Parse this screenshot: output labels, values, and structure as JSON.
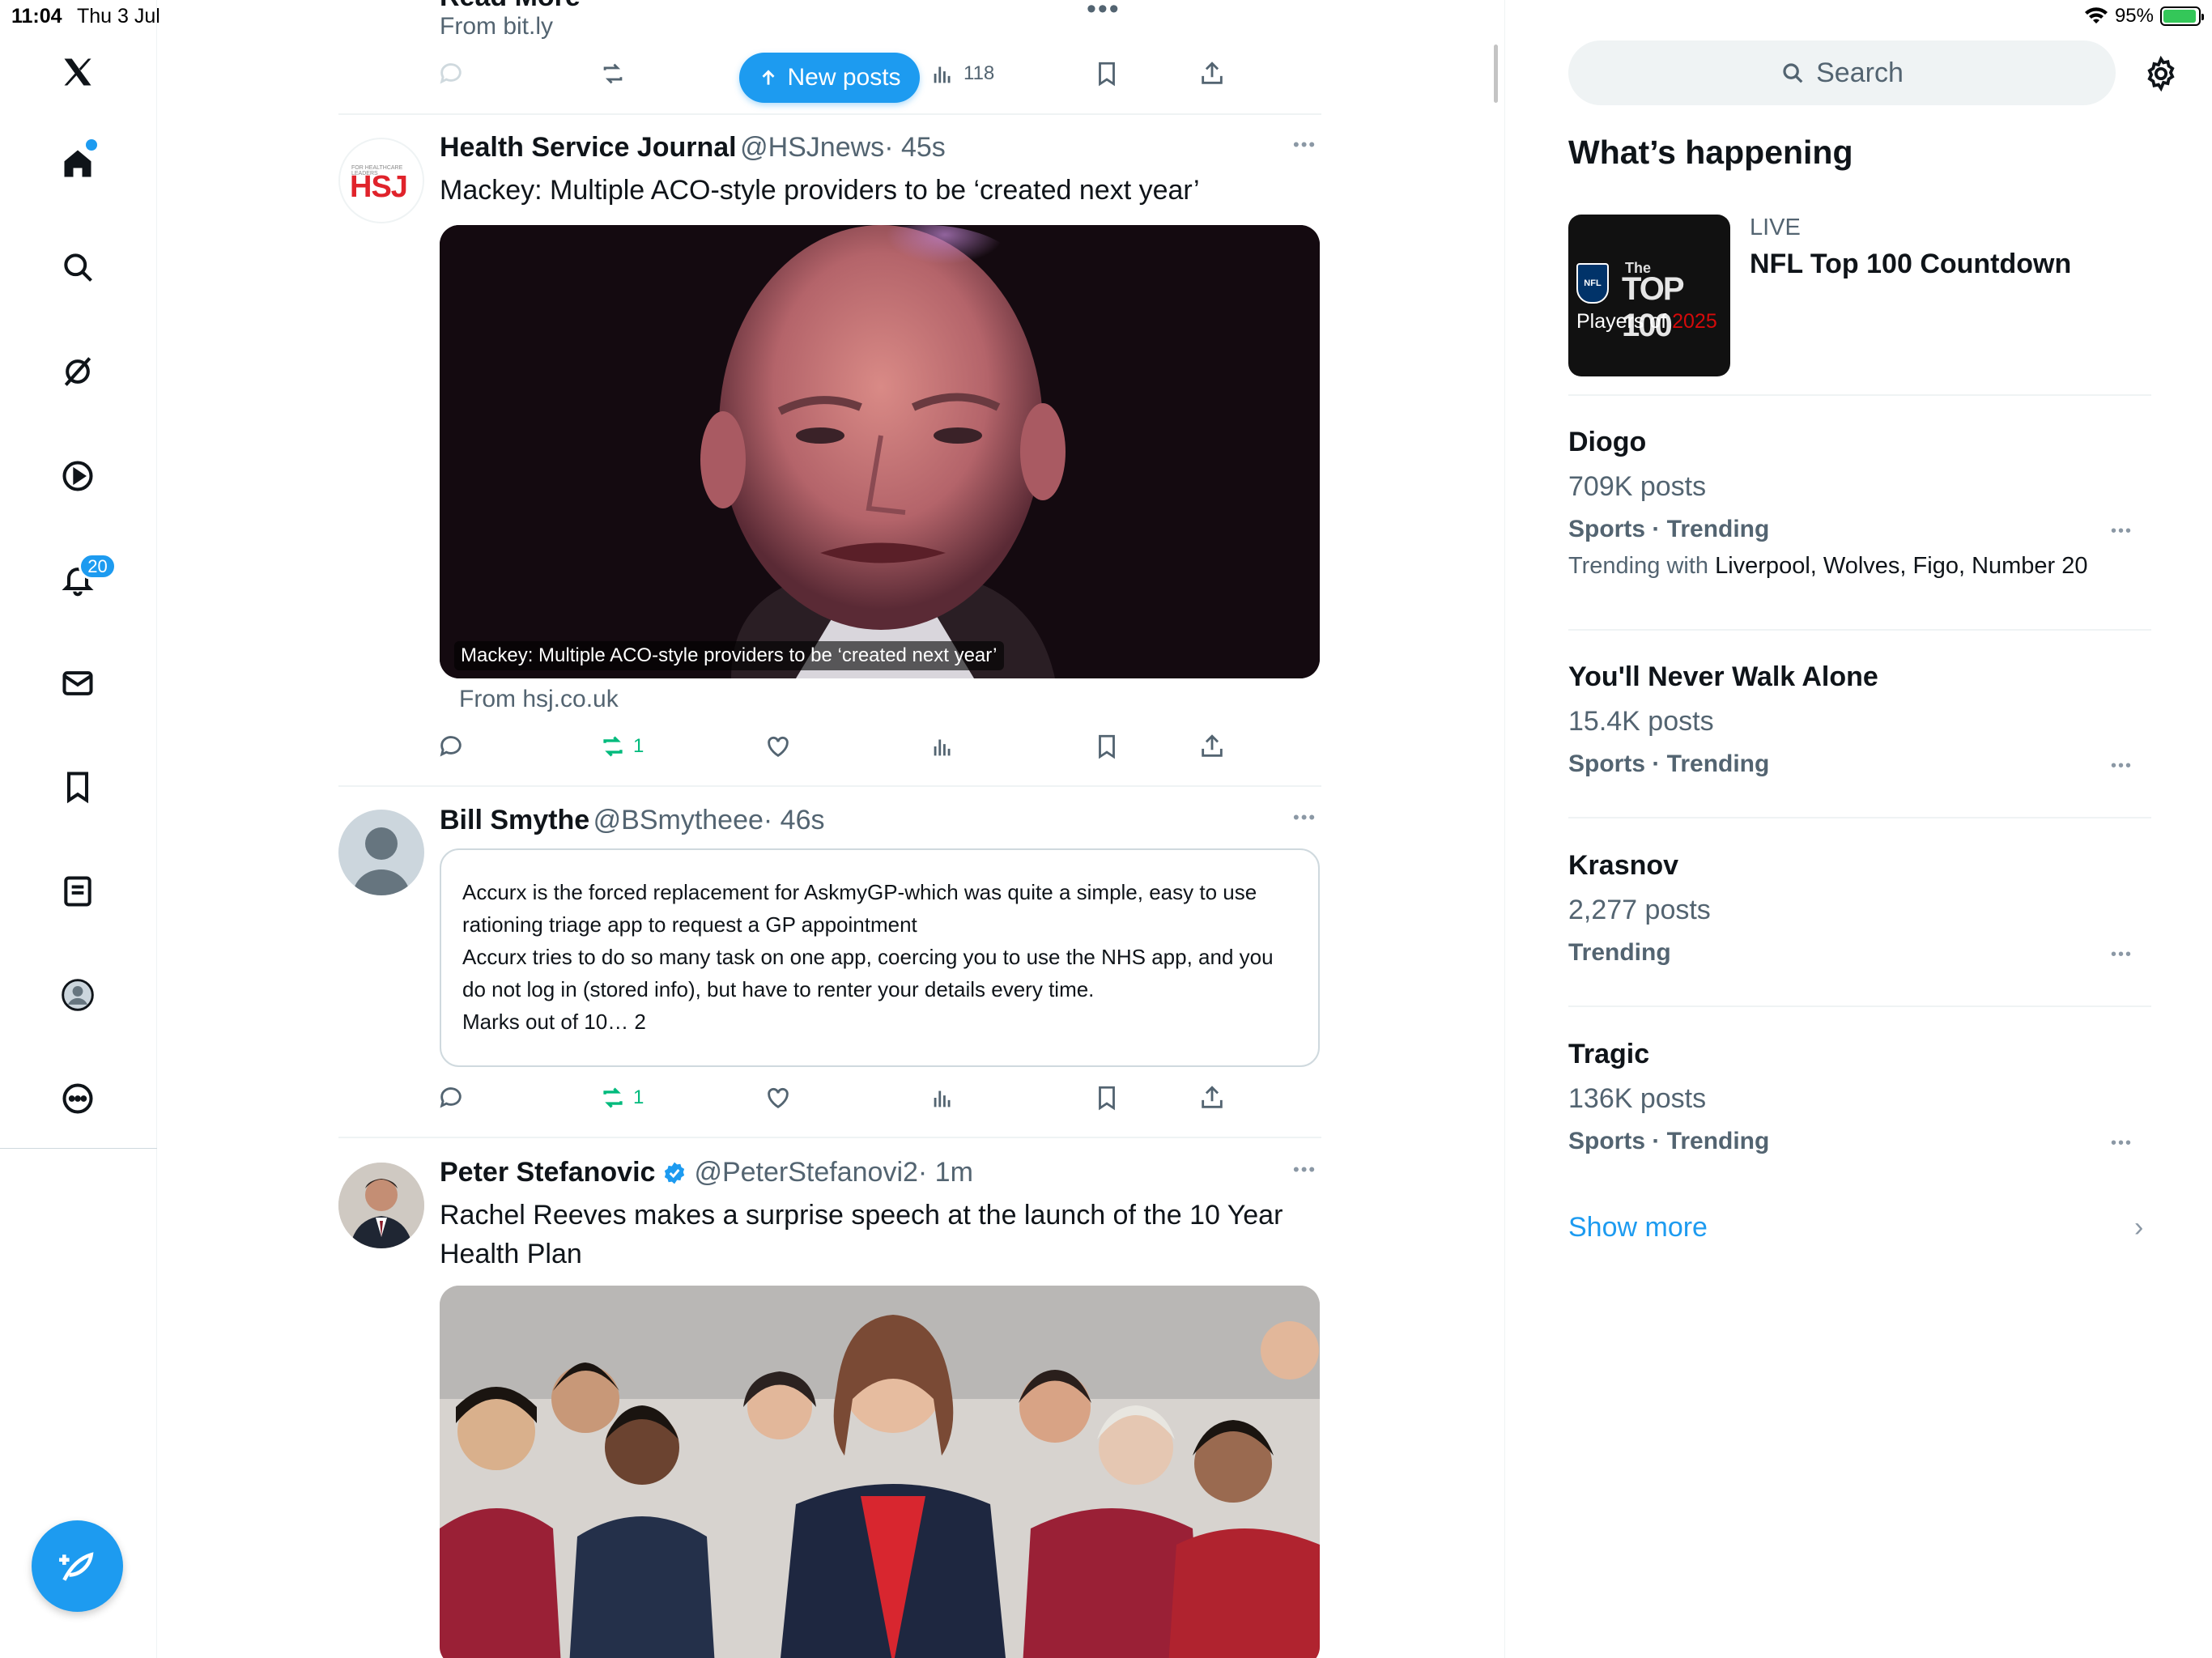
{
  "status": {
    "time": "11:04",
    "date": "Thu 3 Jul",
    "battery": "95%",
    "battery_level": 0.95
  },
  "nav": {
    "notifications_badge": "20"
  },
  "top_post": {
    "read_more": "Read More",
    "from": "From bit.ly",
    "views": "118"
  },
  "new_posts_label": "New posts",
  "posts": [
    {
      "name": "Health Service Journal",
      "handle": "@HSJnews",
      "time": "· 45s",
      "avatar_text": "HSJ",
      "avatar_tag": "FOR HEALTHCARE LEADERS",
      "text": "Mackey: Multiple ACO-style providers to be ‘created next year’",
      "card_caption": "Mackey: Multiple ACO-style providers to be ‘created next year’",
      "from": "From hsj.co.uk",
      "retweets": "1"
    },
    {
      "name": "Bill Smythe",
      "handle": "@BSmytheee",
      "time": "· 46s",
      "quote_lines": [
        "Accurx is the forced replacement for AskmyGP-which was quite a simple, easy to use",
        "rationing triage app to request a GP appointment",
        "Accurx tries to do so many task on one app, coercing you to use the NHS app, and you",
        "do not log in (stored info), but have to renter your details every time.",
        "Marks out of 10… 2"
      ],
      "retweets": "1"
    },
    {
      "name": "Peter Stefanovic",
      "handle": "@PeterStefanovi2",
      "time": "· 1m",
      "text_line1": "Rachel Reeves makes a surprise speech at the launch of the 10 Year",
      "text_line2": "Health Plan"
    }
  ],
  "sidebar": {
    "search_placeholder": "Search",
    "heading": "What’s happening",
    "live": {
      "label": "LIVE",
      "title": "NFL Top 100 Countdown",
      "thumb_line1": "The",
      "thumb_line2": "TOP 100",
      "thumb_line3": "Players of",
      "thumb_year": "2025",
      "thumb_logo": "NFL"
    },
    "trends": [
      {
        "title": "Diogo",
        "count": "709K posts",
        "meta": "Sports · Trending",
        "with_label": "Trending with",
        "with": "Liverpool, Wolves, Figo, Number 20"
      },
      {
        "title": "You'll Never Walk Alone",
        "count": "15.4K posts",
        "meta": "Sports · Trending"
      },
      {
        "title": "Krasnov",
        "count": "2,277 posts",
        "meta": "Trending"
      },
      {
        "title": "Tragic",
        "count": "136K posts",
        "meta": "Sports · Trending"
      }
    ],
    "show_more": "Show more"
  }
}
